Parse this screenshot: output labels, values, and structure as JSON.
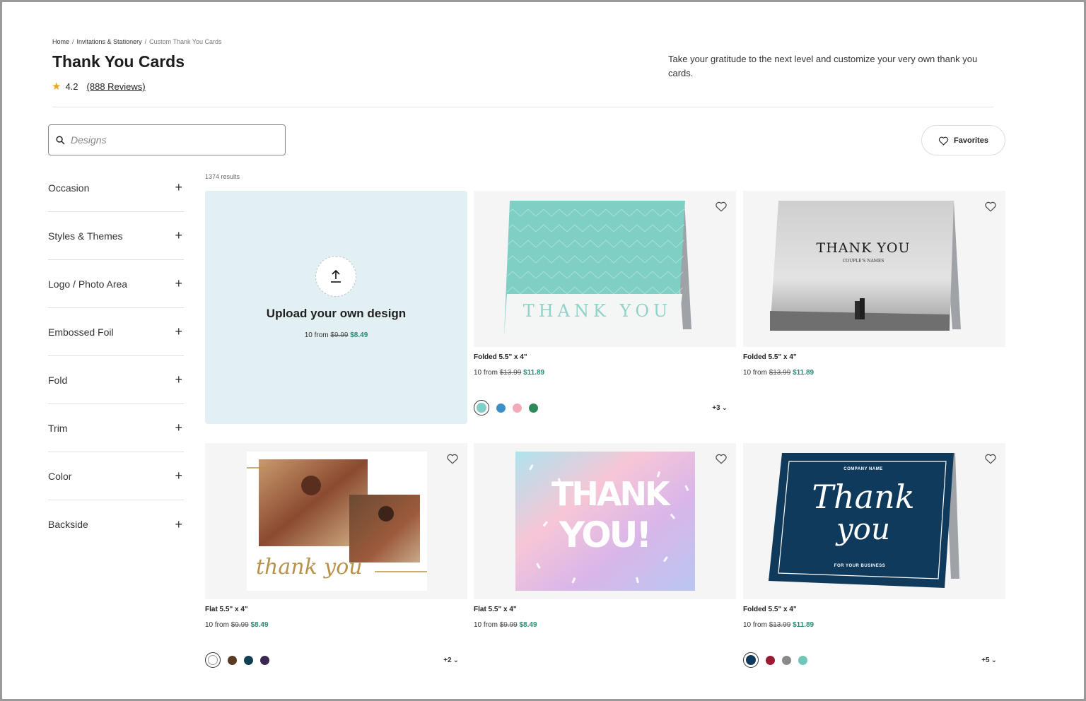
{
  "breadcrumb": {
    "home": "Home",
    "category": "Invitations & Stationery",
    "current": "Custom Thank You Cards"
  },
  "page": {
    "title": "Thank You Cards",
    "rating": "4.2",
    "reviews": "(888 Reviews)",
    "intro": "Take your gratitude to the next level and customize your very own thank you cards."
  },
  "search": {
    "placeholder": "Designs"
  },
  "favorites": {
    "label": "Favorites"
  },
  "filters": [
    {
      "label": "Occasion"
    },
    {
      "label": "Styles & Themes"
    },
    {
      "label": "Logo / Photo Area"
    },
    {
      "label": "Embossed Foil"
    },
    {
      "label": "Fold"
    },
    {
      "label": "Trim"
    },
    {
      "label": "Color"
    },
    {
      "label": "Backside"
    }
  ],
  "results": "1374 results",
  "upload": {
    "title": "Upload your own design",
    "qty": "10 from",
    "old_price": "$9.99",
    "new_price": "$8.49"
  },
  "cards": [
    {
      "format": "Folded 5.5\" x 4\"",
      "qty": "10 from",
      "old_price": "$13.99",
      "new_price": "$11.89",
      "art_text": "THANK YOU",
      "swatches": [
        "#7fcfc4",
        "#3d8fc7",
        "#f2aab9",
        "#2f8a5a"
      ],
      "more": "+3"
    },
    {
      "format": "Folded 5.5\" x 4\"",
      "qty": "10 from",
      "old_price": "$13.99",
      "new_price": "$11.89",
      "art_text": "THANK YOU",
      "art_sub": "COUPLE'S NAMES"
    },
    {
      "format": "Flat 5.5\" x 4\"",
      "qty": "10 from",
      "old_price": "$9.99",
      "new_price": "$8.49",
      "art_text": "thank you",
      "swatches": [
        "#ffffff",
        "#5a3a22",
        "#123f52",
        "#3a2850"
      ],
      "more": "+2"
    },
    {
      "format": "Flat 5.5\" x 4\"",
      "qty": "10 from",
      "old_price": "$9.99",
      "new_price": "$8.49",
      "art_text": "THANK",
      "art_text2": "YOU!"
    },
    {
      "format": "Folded 5.5\" x 4\"",
      "qty": "10 from",
      "old_price": "$13.99",
      "new_price": "$11.89",
      "art_text": "Thank",
      "art_text2": "you",
      "art_top": "COMPANY NAME",
      "art_bottom": "FOR YOUR BUSINESS",
      "swatches": [
        "#0f3a5c",
        "#9b1b35",
        "#8a8a8a",
        "#6fc8b5"
      ],
      "more": "+5"
    }
  ],
  "colors": {
    "accent_price": "#2a8a74",
    "upload_bg": "#e2f0f4",
    "star": "#e9a82a"
  }
}
